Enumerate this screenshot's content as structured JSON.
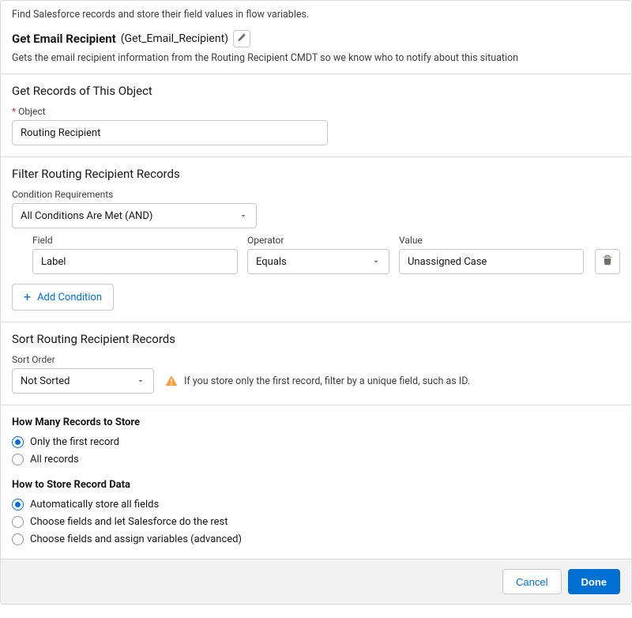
{
  "intro": "Find Salesforce records and store their field values in flow variables.",
  "title": {
    "label": "Get Email Recipient",
    "apiName": "(Get_Email_Recipient)"
  },
  "description": "Gets the email recipient information from the Routing Recipient CMDT so we know who to notify about this situation",
  "getRecords": {
    "heading": "Get Records of This Object",
    "objectLabel": "Object",
    "objectValue": "Routing Recipient"
  },
  "filter": {
    "heading": "Filter Routing Recipient Records",
    "conditionReqLabel": "Condition Requirements",
    "conditionReqValue": "All Conditions Are Met (AND)",
    "cols": {
      "field": "Field",
      "operator": "Operator",
      "value": "Value"
    },
    "row": {
      "field": "Label",
      "operator": "Equals",
      "value": "Unassigned Case"
    },
    "addCondition": "Add Condition"
  },
  "sort": {
    "heading": "Sort Routing Recipient Records",
    "label": "Sort Order",
    "value": "Not Sorted",
    "warning": "If you store only the first record, filter by a unique field, such as ID."
  },
  "store": {
    "howManyHeading": "How Many Records to Store",
    "onlyFirst": "Only the first record",
    "allRecords": "All records",
    "howStoreHeading": "How to Store Record Data",
    "auto": "Automatically store all fields",
    "chooseFields": "Choose fields and let Salesforce do the rest",
    "advanced": "Choose fields and assign variables (advanced)"
  },
  "footer": {
    "cancel": "Cancel",
    "done": "Done"
  }
}
